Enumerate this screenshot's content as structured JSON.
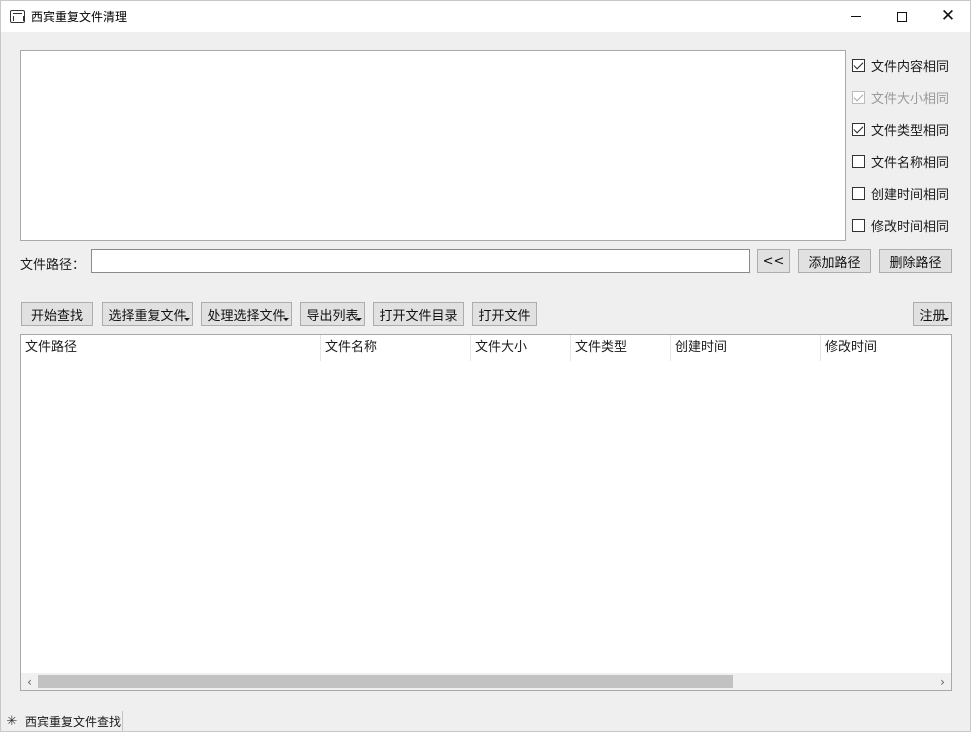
{
  "window": {
    "title": "西宾重复文件清理",
    "min_icon": "minimize-icon",
    "max_icon": "maximize-icon",
    "close_icon": "close-icon"
  },
  "options": [
    {
      "label": "文件内容相同",
      "checked": true,
      "disabled": false
    },
    {
      "label": "文件大小相同",
      "checked": true,
      "disabled": true
    },
    {
      "label": "文件类型相同",
      "checked": true,
      "disabled": false
    },
    {
      "label": "文件名称相同",
      "checked": false,
      "disabled": false
    },
    {
      "label": "创建时间相同",
      "checked": false,
      "disabled": false
    },
    {
      "label": "修改时间相同",
      "checked": false,
      "disabled": false
    }
  ],
  "path": {
    "label": "文件路径：",
    "value": "",
    "browse_label": "<<",
    "add_label": "添加路径",
    "delete_label": "删除路径"
  },
  "toolbar": {
    "start": "开始查找",
    "select_dup": "选择重复文件",
    "process": "处理选择文件",
    "export": "导出列表",
    "open_dir": "打开文件目录",
    "open_file": "打开文件",
    "register": "注册"
  },
  "table": {
    "columns": [
      "文件路径",
      "文件名称",
      "文件大小",
      "文件类型",
      "创建时间",
      "修改时间"
    ],
    "rows": []
  },
  "status": {
    "text": "西宾重复文件查找"
  }
}
